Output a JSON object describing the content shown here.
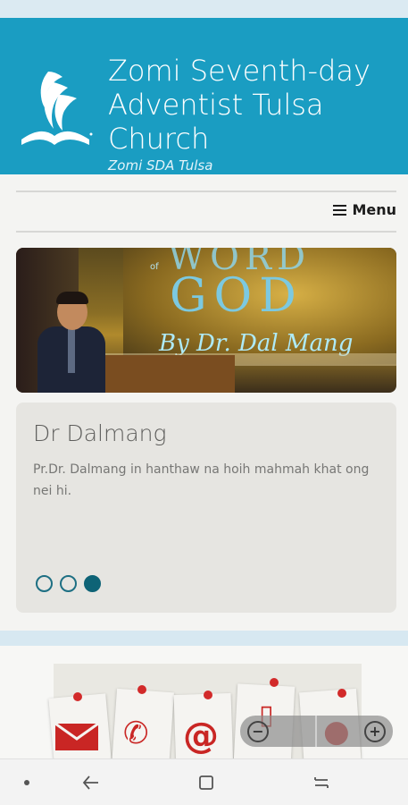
{
  "header": {
    "title": "Zomi Seventh-day Adventist Tulsa Church",
    "subtitle": "Zomi SDA Tulsa"
  },
  "nav": {
    "menu_label": "Menu"
  },
  "slideshow": {
    "image_text": {
      "word": "WORD",
      "of": "of",
      "god": "GOD",
      "byline": "By Dr. Dal Mang"
    },
    "slide_title": "Dr Dalmang",
    "slide_text": "Pr.Dr. Dalmang in hanthaw na hoih mahmah khat ong nei hi.",
    "dots": [
      false,
      false,
      true
    ]
  },
  "contact_icons": [
    "envelope-icon",
    "phone-icon",
    "at-icon",
    "mobile-phone-icon",
    "location-icon"
  ],
  "zoom": {
    "zoom_out_symbol": "−",
    "zoom_in_symbol": "+"
  },
  "colors": {
    "header_bg": "#1a9dc2",
    "dot_active": "#0e6376",
    "contact_red": "#c92624"
  }
}
